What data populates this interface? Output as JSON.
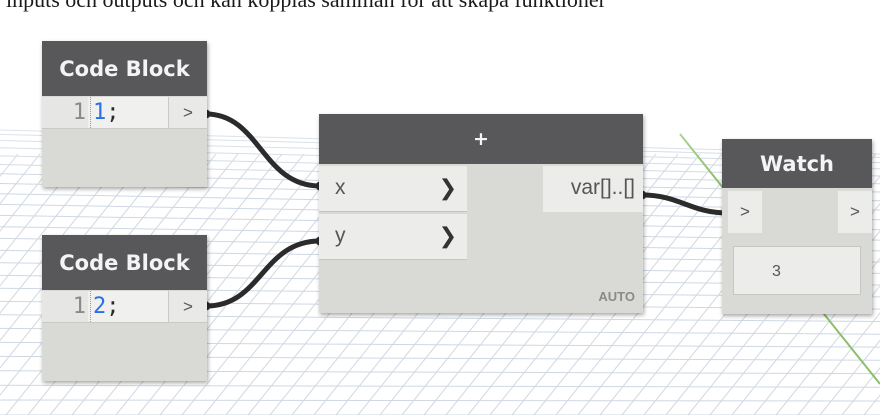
{
  "caption": "inputs och outputs och kan kopplas samman för att skapa funktioner",
  "nodes": {
    "code_block_1": {
      "title": "Code Block",
      "line_number": "1",
      "code_value": "1",
      "code_terminator": ";",
      "output_port": ">"
    },
    "code_block_2": {
      "title": "Code Block",
      "line_number": "1",
      "code_value": "2",
      "code_terminator": ";",
      "output_port": ">"
    },
    "add": {
      "title": "+",
      "inputs": [
        {
          "label": "x",
          "port_icon": "chevron-right"
        },
        {
          "label": "y",
          "port_icon": "chevron-right"
        }
      ],
      "output": "var[]..[]",
      "lacing": "AUTO"
    },
    "watch": {
      "title": "Watch",
      "input_port": ">",
      "output_port": ">",
      "value": "3"
    }
  },
  "colors": {
    "node_header": "#58585a",
    "node_body": "#d9d9d6",
    "wire": "#2b2b2b",
    "grid_line": "#cfd8e3",
    "grid_axis": "#8cbf6a",
    "code_number": "#2b6ee6"
  }
}
